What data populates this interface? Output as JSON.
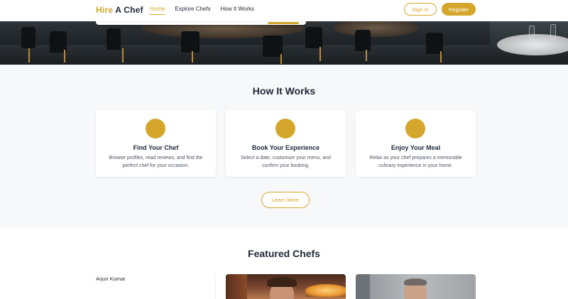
{
  "brand": {
    "part1": "Hire",
    "part2": "A Chef",
    "accent_color": "#d4a72c"
  },
  "nav": {
    "items": [
      {
        "label": "Home",
        "active": true
      },
      {
        "label": "Explore Chefs",
        "active": false
      },
      {
        "label": "How It Works",
        "active": false
      }
    ]
  },
  "auth": {
    "signin_label": "Sign In",
    "register_label": "Register"
  },
  "how_it_works": {
    "title": "How It Works",
    "steps": [
      {
        "title": "Find Your Chef",
        "description": "Browse profiles, read reviews, and find the perfect chef for your occasion."
      },
      {
        "title": "Book Your Experience",
        "description": "Select a date, customize your menu, and confirm your booking."
      },
      {
        "title": "Enjoy Your Meal",
        "description": "Relax as your chef prepares a memorable culinary experience in your home."
      }
    ],
    "learn_more_label": "Learn More"
  },
  "featured": {
    "title": "Featured Chefs",
    "chefs": [
      {
        "name": "Arjun Kumar"
      }
    ]
  }
}
